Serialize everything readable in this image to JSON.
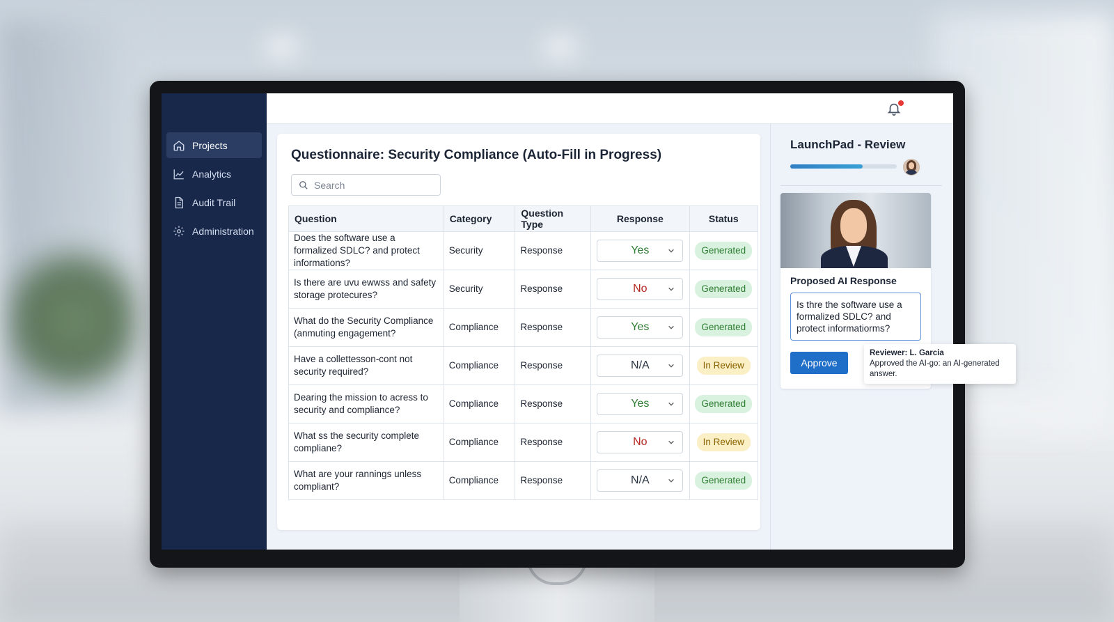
{
  "nav": {
    "items": [
      {
        "label": "Projects",
        "icon": "home-icon",
        "active": true
      },
      {
        "label": "Analytics",
        "icon": "chart-line-icon",
        "active": false
      },
      {
        "label": "Audit Trail",
        "icon": "document-icon",
        "active": false
      },
      {
        "label": "Administration",
        "icon": "gear-icon",
        "active": false
      }
    ]
  },
  "main": {
    "title": "Questionnaire: Security Compliance (Auto-Fill in Progress)",
    "search_placeholder": "Search",
    "columns": [
      "Question",
      "Category",
      "Question Type",
      "Response",
      "Status"
    ],
    "rows": [
      {
        "question": "Does the software use a formalized SDLC? and protect informations?",
        "category": "Security",
        "type": "Response",
        "response": "Yes",
        "status": "Generated"
      },
      {
        "question": "Is there are uvu ewwss and safety storage protecures?",
        "category": "Security",
        "type": "Response",
        "response": "No",
        "status": "Generated"
      },
      {
        "question": "What do the Security Compliance (anmuting engagement?",
        "category": "Compliance",
        "type": "Response",
        "response": "Yes",
        "status": "Generated"
      },
      {
        "question": "Have a collettesson-cont not security required?",
        "category": "Compliance",
        "type": "Response",
        "response": "N/A",
        "status": "In Review"
      },
      {
        "question": "Dearing the mission to acress to security and compliance?",
        "category": "Compliance",
        "type": "Response",
        "response": "Yes",
        "status": "Generated"
      },
      {
        "question": "What ss the security complete compliane?",
        "category": "Compliance",
        "type": "Response",
        "response": "No",
        "status": "In Review"
      },
      {
        "question": "What are your rannings unless compliant?",
        "category": "Compliance",
        "type": "Response",
        "response": "N/A",
        "status": "Generated"
      }
    ]
  },
  "review": {
    "title": "LaunchPad - Review",
    "progress": 0.68,
    "proposed_label": "Proposed AI Response",
    "proposed_text": "Is thre the software use a formalized SDLC? and protect informatiorms?",
    "approve_label": "Approve",
    "tooltip_reviewer": "Reviewer: L. Garcia",
    "tooltip_text": "Approved the AI-go: an AI-generated answer."
  },
  "colors": {
    "sidebar": "#17284b",
    "accent": "#1f6fc9",
    "generated": "#2e7d32",
    "in_review": "#8a6200",
    "no": "#b3261e",
    "notification_dot": "#e53935"
  }
}
